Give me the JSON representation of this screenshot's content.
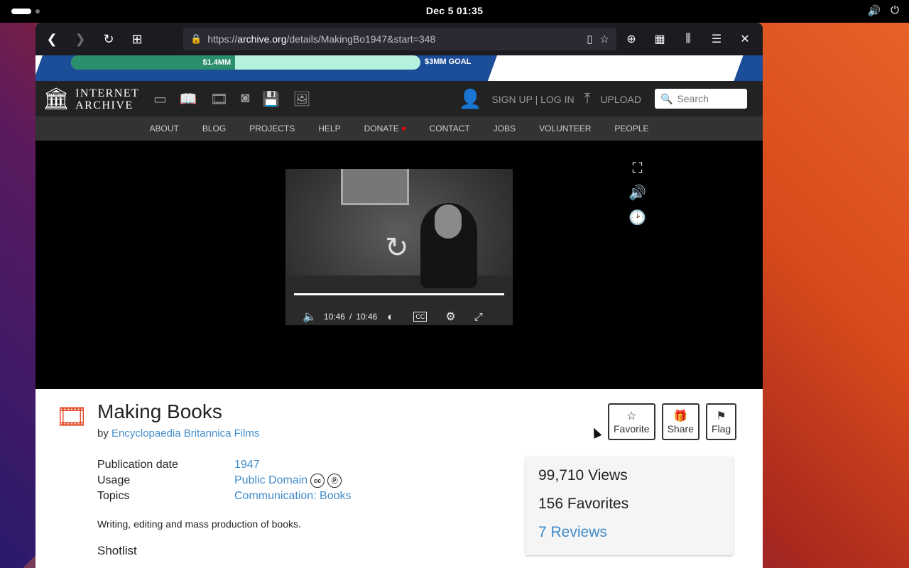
{
  "system": {
    "clock": "Dec 5  01:35",
    "volume_icon": "speaker",
    "power_icon": "power"
  },
  "browser": {
    "url_host": "archive.org",
    "url_prefix": "https://",
    "url_path": "/details/MakingBo1947&start=348"
  },
  "banner": {
    "raised": "$1.4MM",
    "goal": "$3MM GOAL",
    "progress_fraction": 0.47
  },
  "header": {
    "logo_line1": "INTERNET",
    "logo_line2": "ARCHIVE",
    "signup": "SIGN UP",
    "separator": "|",
    "login": "LOG IN",
    "upload": "UPLOAD",
    "search_placeholder": "Search"
  },
  "nav": {
    "items": [
      "ABOUT",
      "BLOG",
      "PROJECTS",
      "HELP",
      "DONATE",
      "CONTACT",
      "JOBS",
      "VOLUNTEER",
      "PEOPLE"
    ]
  },
  "player": {
    "current_time": "10:46",
    "time_sep": "/",
    "duration": "10:46",
    "cc_label": "CC",
    "progress_fraction": 1.0
  },
  "item": {
    "title": "Making Books",
    "by_label": "by",
    "creator": "Encyclopaedia Britannica Films",
    "actions": {
      "favorite": "Favorite",
      "share": "Share",
      "flag": "Flag"
    },
    "fields": {
      "pubdate_label": "Publication date",
      "pubdate": "1947",
      "usage_label": "Usage",
      "usage": "Public Domain",
      "topics_label": "Topics",
      "topics": "Communication: Books"
    },
    "description": "Writing, editing and mass production of books.",
    "shotlist": "Shotlist"
  },
  "stats": {
    "views": "99,710 Views",
    "favorites": "156 Favorites",
    "reviews": "7 Reviews"
  },
  "colors": {
    "accent_link": "#428bca",
    "film_icon": "#e34b2a",
    "banner_blue": "#1b4d98",
    "banner_fill": "#2b8f6e"
  }
}
